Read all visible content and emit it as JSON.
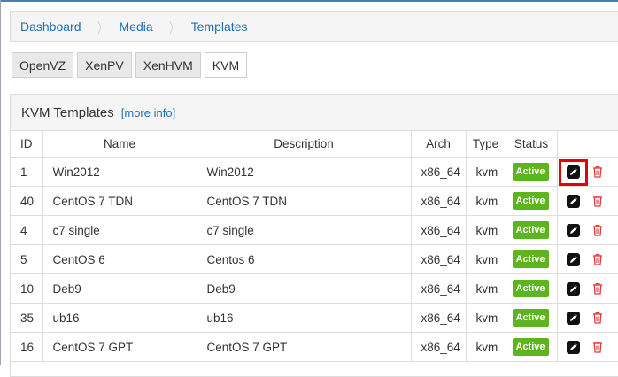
{
  "breadcrumb": [
    "Dashboard",
    "Media",
    "Templates"
  ],
  "tabs": [
    {
      "label": "OpenVZ",
      "active": false
    },
    {
      "label": "XenPV",
      "active": false
    },
    {
      "label": "XenHVM",
      "active": false
    },
    {
      "label": "KVM",
      "active": true
    }
  ],
  "panel": {
    "title": "KVM Templates",
    "more_info": "[more info]"
  },
  "table": {
    "headers": {
      "id": "ID",
      "name": "Name",
      "description": "Description",
      "arch": "Arch",
      "type": "Type",
      "status": "Status"
    },
    "rows": [
      {
        "id": "1",
        "name": "Win2012",
        "description": "Win2012",
        "arch": "x86_64",
        "type": "kvm",
        "status": "Active"
      },
      {
        "id": "40",
        "name": "CentOS 7 TDN",
        "description": "CentOS 7 TDN",
        "arch": "x86_64",
        "type": "kvm",
        "status": "Active"
      },
      {
        "id": "4",
        "name": "c7 single",
        "description": "c7 single",
        "arch": "x86_64",
        "type": "kvm",
        "status": "Active"
      },
      {
        "id": "5",
        "name": "CentOS 6",
        "description": "Centos 6",
        "arch": "x86_64",
        "type": "kvm",
        "status": "Active"
      },
      {
        "id": "10",
        "name": "Deb9",
        "description": "Deb9",
        "arch": "x86_64",
        "type": "kvm",
        "status": "Active"
      },
      {
        "id": "35",
        "name": "ub16",
        "description": "ub16",
        "arch": "x86_64",
        "type": "kvm",
        "status": "Active"
      },
      {
        "id": "16",
        "name": "CentOS 7 GPT",
        "description": "CentOS 7 GPT",
        "arch": "x86_64",
        "type": "kvm",
        "status": "Active"
      }
    ]
  },
  "icons": {
    "edit": "pencil-icon",
    "delete": "trash-icon"
  },
  "colors": {
    "link": "#1f6fb6",
    "status_active": "#5cb51f",
    "delete": "#e03b3b",
    "highlight": "#e60000"
  }
}
